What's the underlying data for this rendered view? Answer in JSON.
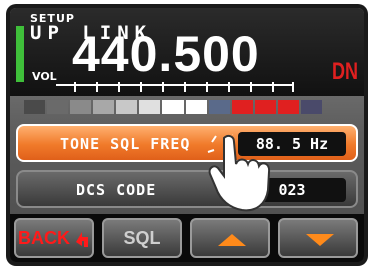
{
  "header": {
    "mode_label": "SETUP",
    "title": "UP LINK",
    "vol_label": "VOL",
    "frequency": "440.500",
    "shift_indicator": "DN"
  },
  "signal_meter": {
    "colors": {
      "low": "#cfcfcf",
      "mid": "#e8e8e8",
      "high": "#e02020",
      "tail": "#5a5a7a"
    }
  },
  "menu": {
    "items": [
      {
        "label": "TONE SQL FREQ",
        "value": "88. 5 Hz",
        "selected": true
      },
      {
        "label": "DCS CODE",
        "value": "023",
        "selected": false
      }
    ]
  },
  "softkeys": {
    "back": "BACK",
    "sql": "SQL",
    "up_icon": "arrow-up-icon",
    "down_icon": "arrow-down-icon"
  },
  "colors": {
    "accent_orange": "#f07a2a",
    "arrow_orange": "#ff8a1a",
    "green_indicator": "#3fbf3a",
    "red": "#e02020"
  }
}
